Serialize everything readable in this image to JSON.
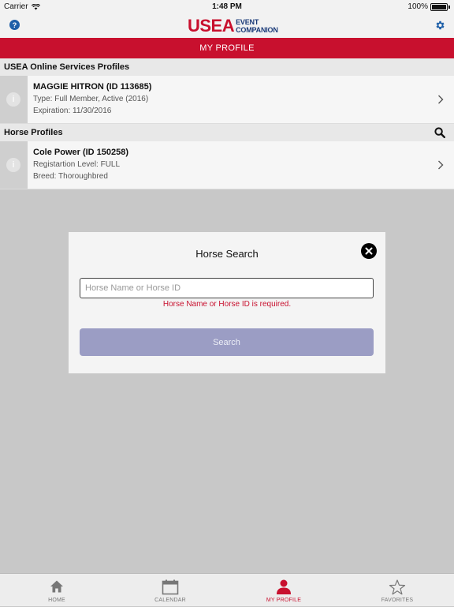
{
  "status_bar": {
    "carrier": "Carrier",
    "time": "1:48 PM",
    "battery": "100%"
  },
  "nav": {
    "logo_main": "USEA",
    "logo_sub_1": "EVENT",
    "logo_sub_2": "COMPANION",
    "icons": [
      "help-icon",
      "gear-icon"
    ]
  },
  "title_bar": {
    "title": "MY PROFILE"
  },
  "sections": {
    "usea_profiles": {
      "header": "USEA Online Services Profiles",
      "items": [
        {
          "title": "MAGGIE HITRON (ID 113685)",
          "line1": "Type: Full Member, Active (2016)",
          "line2": "Expiration: 11/30/2016"
        }
      ]
    },
    "horse_profiles": {
      "header": "Horse Profiles",
      "items": [
        {
          "title": "Cole Power (ID 150258)",
          "line1": "Registartion Level: FULL",
          "line2": "Breed: Thoroughbred"
        }
      ]
    }
  },
  "modal": {
    "title": "Horse Search",
    "input_value": "",
    "input_placeholder": "Horse Name or Horse ID",
    "error": "Horse Name or Horse ID is required.",
    "button": "Search"
  },
  "tabs": [
    {
      "label": "HOME",
      "icon": "home-icon",
      "active": false
    },
    {
      "label": "CALENDAR",
      "icon": "calendar-icon",
      "active": false
    },
    {
      "label": "MY PROFILE",
      "icon": "person-icon",
      "active": true
    },
    {
      "label": "FAVORITES",
      "icon": "star-icon",
      "active": false
    }
  ],
  "colors": {
    "brand_red": "#c8102e",
    "brand_navy": "#1a3a78",
    "button_disabled": "#9b9dc4",
    "overlay": "#c8c8c8"
  }
}
